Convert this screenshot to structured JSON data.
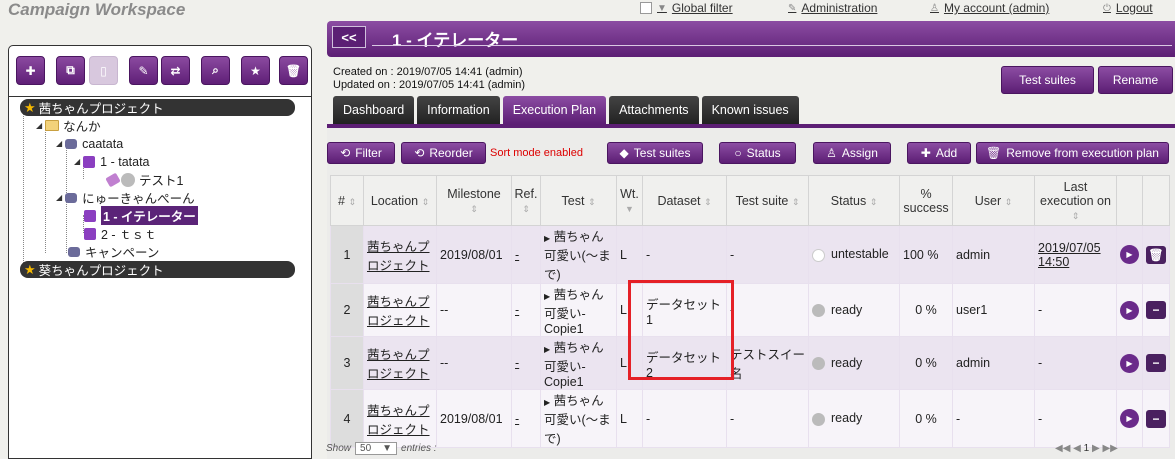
{
  "app_title": "Campaign Workspace",
  "top_nav": {
    "global_filter": "Global filter",
    "administration": "Administration",
    "my_account": "My account (admin)",
    "logout": "Logout"
  },
  "iteration": {
    "back": "<<",
    "title": "1 - イテレーター",
    "created_on": "Created on :  2019/07/05 14:41 (admin)",
    "updated_on": "Updated on :  2019/07/05 14:41 (admin)",
    "test_suites_btn": "Test suites",
    "rename_btn": "Rename"
  },
  "tree": {
    "project1": "茜ちゃんプロジェクト",
    "folder": "なんか",
    "campaign1": "caatata",
    "iter1": "1 - tatata",
    "suite": "テスト1",
    "campaign2": "にゅーきゃんぺーん",
    "iter_selected": "1 - イテレーター",
    "iter2": "2 - ｔｓｔ",
    "campaign3": "キャンペーン",
    "project2": "葵ちゃんプロジェクト"
  },
  "tabs": [
    "Dashboard",
    "Information",
    "Execution Plan",
    "Attachments",
    "Known issues"
  ],
  "actions": {
    "filter": "Filter",
    "reorder": "Reorder",
    "sort_msg": "Sort mode enabled",
    "test_suites": "Test suites",
    "status": "Status",
    "assign": "Assign",
    "add": "Add",
    "remove": "Remove from execution plan"
  },
  "columns": {
    "num": "#",
    "location": "Location",
    "milestone": "Milestone",
    "ref": "Ref.",
    "test": "Test",
    "wt": "Wt.",
    "dataset": "Dataset",
    "suite": "Test suite",
    "status": "Status",
    "pct": "% success",
    "user": "User",
    "last": "Last execution on"
  },
  "rows": [
    {
      "num": "1",
      "location": "茜ちゃんプロジェクト",
      "milestone": "2019/08/01",
      "ref": "-",
      "test": "茜ちゃん可愛い(〜まで)",
      "wt": "L",
      "dataset": "-",
      "suite": "-",
      "status": "untestable",
      "pct": "100 %",
      "user": "admin",
      "last": "2019/07/05 14:50"
    },
    {
      "num": "2",
      "location": "茜ちゃんプロジェクト",
      "milestone": "--",
      "ref": "-",
      "test": "茜ちゃん可愛い-Copie1",
      "wt": "L",
      "dataset": "データセット1",
      "suite": "-",
      "status": "ready",
      "pct": "0 %",
      "user": "user1",
      "last": "-"
    },
    {
      "num": "3",
      "location": "茜ちゃんプロジェクト",
      "milestone": "--",
      "ref": "-",
      "test": "茜ちゃん可愛い-Copie1",
      "wt": "L",
      "dataset": "データセット2",
      "suite": "テストスイー名",
      "status": "ready",
      "pct": "0 %",
      "user": "admin",
      "last": "-"
    },
    {
      "num": "4",
      "location": "茜ちゃんプロジェクト",
      "milestone": "2019/08/01",
      "ref": "-",
      "test": "茜ちゃん可愛い(〜まで)",
      "wt": "L",
      "dataset": "-",
      "suite": "-",
      "status": "ready",
      "pct": "0 %",
      "user": "-",
      "last": "-"
    }
  ],
  "footer": {
    "show": "Show",
    "entries_value": "50",
    "entries": "entries :",
    "pager_current": "1"
  },
  "colors": {
    "brand": "#5c1e74",
    "highlight": "#e52027"
  }
}
